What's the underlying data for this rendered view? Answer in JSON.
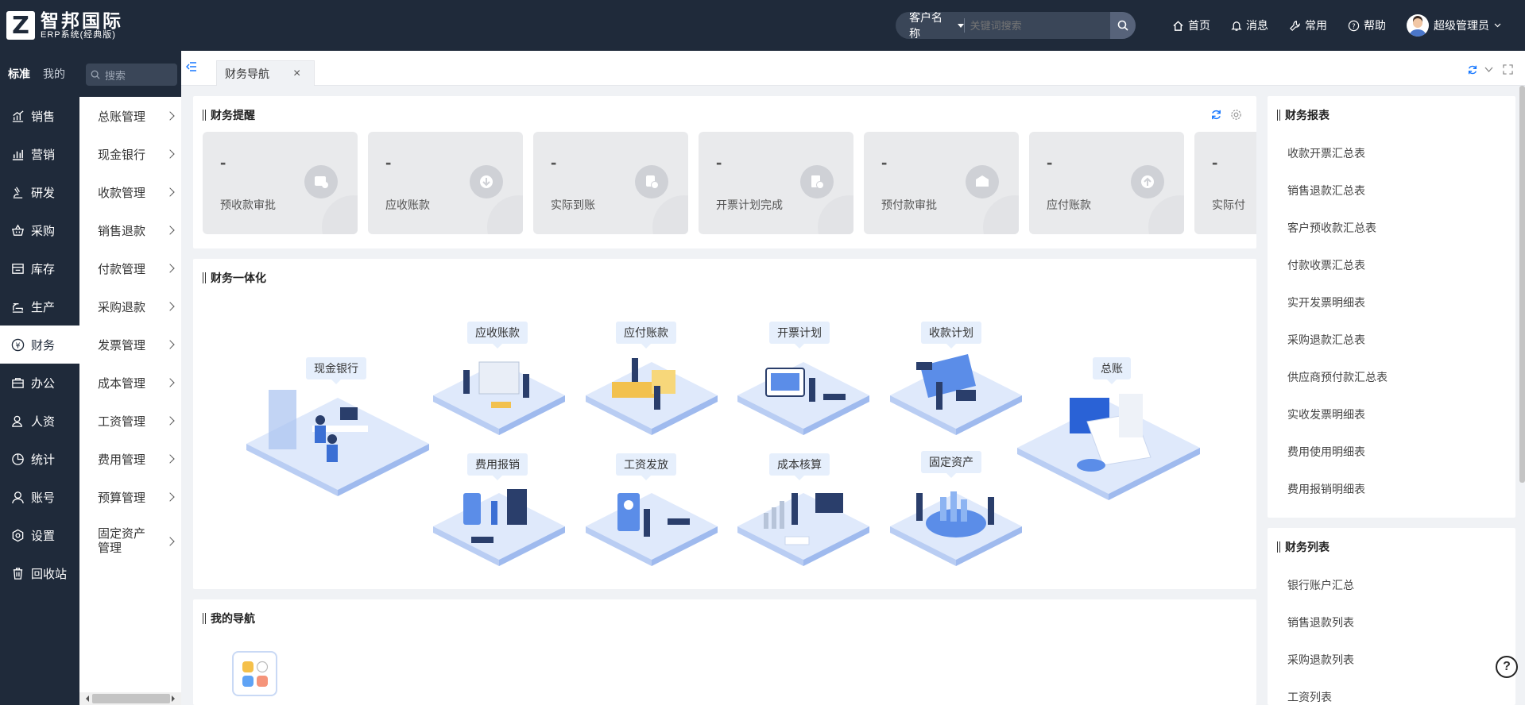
{
  "brand": {
    "logo_letter": "Z",
    "title": "智邦国际",
    "subtitle": "ERP系统(经典版)"
  },
  "search": {
    "type_label": "客户名称",
    "placeholder": "关键词搜索"
  },
  "topnav": {
    "home": "首页",
    "messages": "消息",
    "common": "常用",
    "help": "帮助",
    "user": "超级管理员"
  },
  "leftnav": {
    "tab_standard": "标准",
    "tab_mine": "我的",
    "items": [
      {
        "label": "销售",
        "icon": "chart-icon"
      },
      {
        "label": "营销",
        "icon": "bar-chart-icon"
      },
      {
        "label": "研发",
        "icon": "microscope-icon"
      },
      {
        "label": "采购",
        "icon": "basket-icon"
      },
      {
        "label": "库存",
        "icon": "warehouse-icon"
      },
      {
        "label": "生产",
        "icon": "factory-icon"
      },
      {
        "label": "财务",
        "icon": "yuan-icon"
      },
      {
        "label": "办公",
        "icon": "briefcase-icon"
      },
      {
        "label": "人资",
        "icon": "person-icon"
      },
      {
        "label": "统计",
        "icon": "pie-icon"
      },
      {
        "label": "账号",
        "icon": "user-icon"
      },
      {
        "label": "设置",
        "icon": "settings-icon"
      },
      {
        "label": "回收站",
        "icon": "trash-icon"
      }
    ],
    "active_index": 6
  },
  "subnav": {
    "search_placeholder": "搜索",
    "items": [
      "总账管理",
      "现金银行",
      "收款管理",
      "销售退款",
      "付款管理",
      "采购退款",
      "发票管理",
      "成本管理",
      "工资管理",
      "费用管理",
      "预算管理"
    ],
    "last_item_line1": "固定资产",
    "last_item_line2": "管理"
  },
  "tabs": {
    "active_label": "财务导航",
    "close": "×"
  },
  "remind": {
    "title": "财务提醒",
    "items": [
      {
        "value": "-",
        "label": "预收款审批"
      },
      {
        "value": "-",
        "label": "应收账款"
      },
      {
        "value": "-",
        "label": "实际到账"
      },
      {
        "value": "-",
        "label": "开票计划完成"
      },
      {
        "value": "-",
        "label": "预付款审批"
      },
      {
        "value": "-",
        "label": "应付账款"
      },
      {
        "value": "-",
        "label": "实际付"
      }
    ]
  },
  "integration": {
    "title": "财务一体化",
    "modules": {
      "cash_bank": "现金银行",
      "receivable": "应收账款",
      "payable": "应付账款",
      "invoice_plan": "开票计划",
      "collection_plan": "收款计划",
      "ledger": "总账",
      "expense": "费用报销",
      "salary": "工资发放",
      "cost": "成本核算",
      "assets": "固定资产"
    }
  },
  "my_nav": {
    "title": "我的导航"
  },
  "reports": {
    "title": "财务报表",
    "items": [
      "收款开票汇总表",
      "销售退款汇总表",
      "客户预收款汇总表",
      "付款收票汇总表",
      "实开发票明细表",
      "采购退款汇总表",
      "供应商预付款汇总表",
      "实收发票明细表",
      "费用使用明细表",
      "费用报销明细表"
    ]
  },
  "lists": {
    "title": "财务列表",
    "items": [
      "银行账户汇总",
      "销售退款列表",
      "采购退款列表",
      "工资列表"
    ]
  },
  "help_fab": "?"
}
